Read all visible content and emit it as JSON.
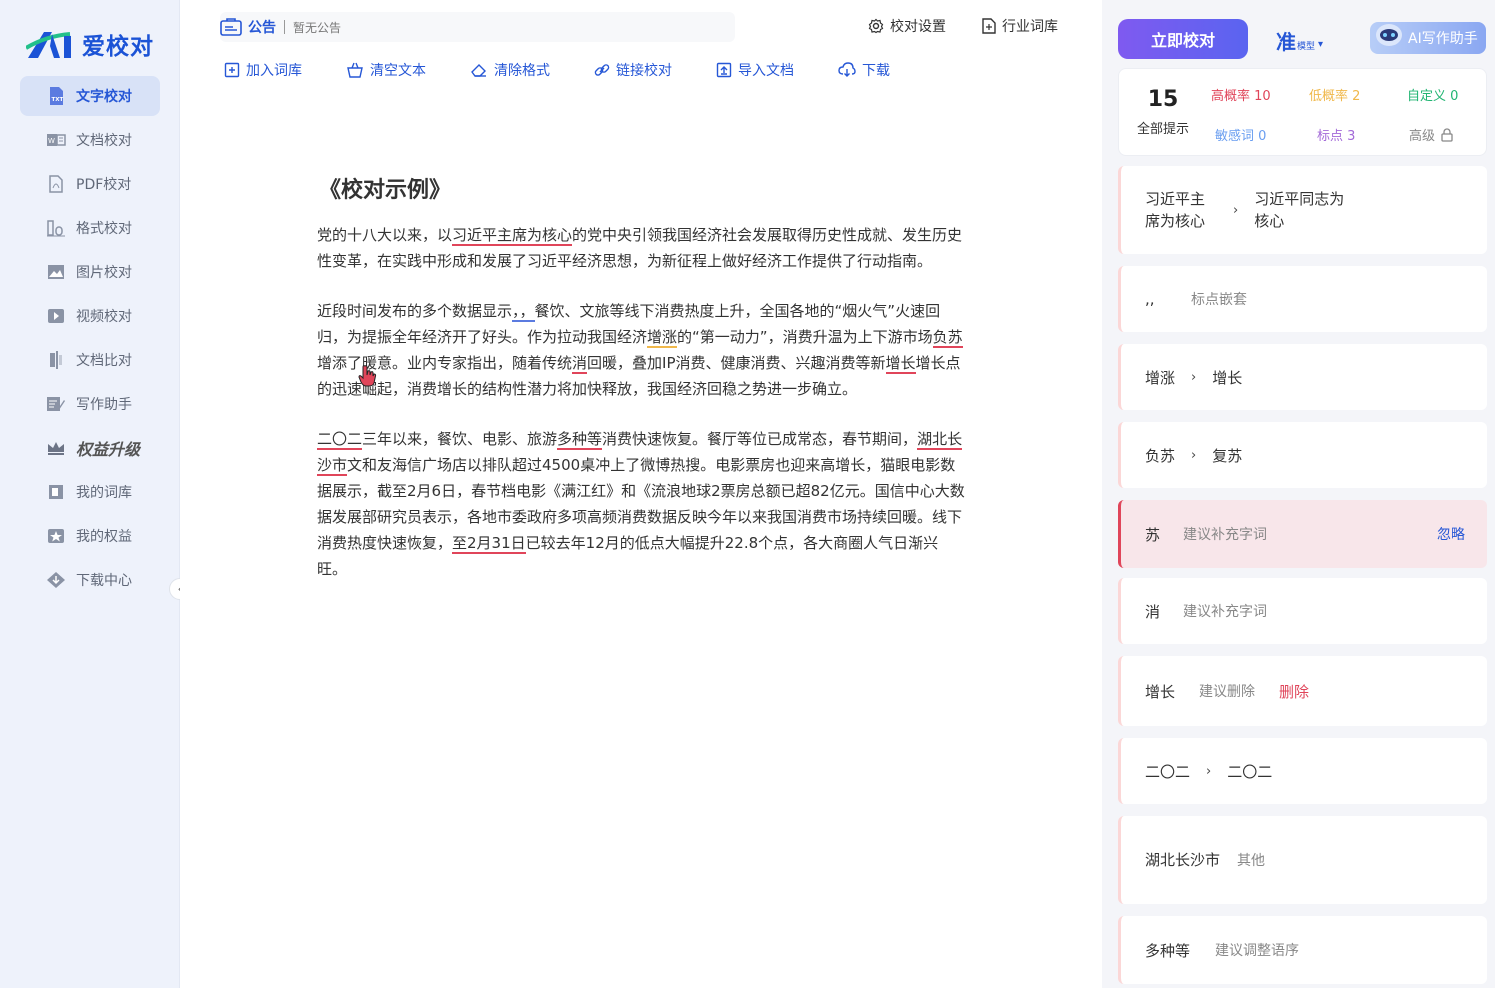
{
  "app": {
    "logo_text": "爱校对"
  },
  "sidebar": {
    "items": [
      {
        "label": "文字校对",
        "icon": "txt-file-icon"
      },
      {
        "label": "文档校对",
        "icon": "word-doc-icon"
      },
      {
        "label": "PDF校对",
        "icon": "pdf-icon"
      },
      {
        "label": "格式校对",
        "icon": "format-icon"
      },
      {
        "label": "图片校对",
        "icon": "image-icon"
      },
      {
        "label": "视频校对",
        "icon": "video-icon"
      },
      {
        "label": "文档比对",
        "icon": "compare-icon"
      },
      {
        "label": "写作助手",
        "icon": "write-icon"
      },
      {
        "label": "权益升级",
        "icon": "crown-icon"
      },
      {
        "label": "我的词库",
        "icon": "dictionary-icon"
      },
      {
        "label": "我的权益",
        "icon": "star-icon"
      },
      {
        "label": "下载中心",
        "icon": "download-center-icon"
      }
    ],
    "collapse_glyph": "‹"
  },
  "notice": {
    "label": "公告",
    "text": "暂无公告"
  },
  "top_links": {
    "settings": "校对设置",
    "industry": "行业词库"
  },
  "toolbar": {
    "add_dict": "加入词库",
    "clear_text": "清空文本",
    "clear_format": "清除格式",
    "link_check": "链接校对",
    "import_doc": "导入文档",
    "download": "下载"
  },
  "document": {
    "title": "《校对示例》",
    "p1": [
      "党的十八大以来，以",
      "习近平主席为核心",
      "的党中央引领我国经济社会发展取得历史性成就、发生历史性变革，在实践中形成和发展了习近平经济思想，为新征程上做好经济工作提供了行动指南。"
    ],
    "p2": [
      "近段时间发布的多个数据显示",
      "，，",
      "餐饮、文旅等线下消费热度上升，全国各地的“烟火气”火速回归，为提振全年经济开了好头。作为拉动我国经济",
      "增涨",
      "的“第一动力”，消费升温为上下游市场",
      "负苏",
      "增添了暖意。业内专家指出，随着传统",
      "消",
      "回暖，叠加IP消费、健康消费、兴趣消费等新",
      "增长",
      "增长点的迅速崛起，消费增长的结构性潜力将加快释放，我国经济回稳之势进一步确立。"
    ],
    "p3": [
      "二〇二",
      "三年以来，餐饮、电影、旅游",
      "多种等",
      "消费快速恢复。餐厅等位已成常态，春节期间，",
      "湖北长沙市",
      "文和友海信广场店以排队超过4500桌冲上了微博热搜。电影票房也迎来高增长，猫眼电影数据展示，截至2月6日，春节档电影《满江红》和《流浪地球2票房总额已超82亿元。",
      "国信中心大数据发展部研究员表示，各地市委政府多项高频消费数据反映今年以来我国消费市场持续回暖。线下消费热度快速恢复，",
      "至2月31日",
      "已较去年12月的低点大幅提升22.8个点，各大商圈人气日渐兴旺。"
    ]
  },
  "right": {
    "check_button": "立即校对",
    "model_big": "准",
    "model_small": "模型",
    "ai_button": "AI写作助手",
    "stats": {
      "total": "15",
      "total_label": "全部提示",
      "high": "高概率 10",
      "low": "低概率 2",
      "custom": "自定义 0",
      "sensitive": "敏感词 0",
      "punct": "标点 3",
      "advanced": "高级"
    },
    "cards": [
      {
        "from": "习近平主席为核心",
        "to": "习近平同志为核心"
      },
      {
        "from": ",,",
        "note": "标点嵌套"
      },
      {
        "from": "增涨",
        "to": "增长"
      },
      {
        "from": "负苏",
        "to": "复苏"
      },
      {
        "from": "苏",
        "note": "建议补充字词",
        "action": "忽略"
      },
      {
        "from": "消",
        "note": "建议补充字词"
      },
      {
        "from": "增长",
        "note": "建议删除",
        "action": "删除"
      },
      {
        "from": "二〇二",
        "to": "二〇二"
      },
      {
        "from": "湖北长沙市",
        "note": "其他"
      },
      {
        "from": "多种等",
        "note": "建议调整语序"
      }
    ]
  },
  "colors": {
    "accent": "#2657d6",
    "error": "#e0455a",
    "warning": "#f0b84b",
    "purple": "#7f5af0"
  }
}
